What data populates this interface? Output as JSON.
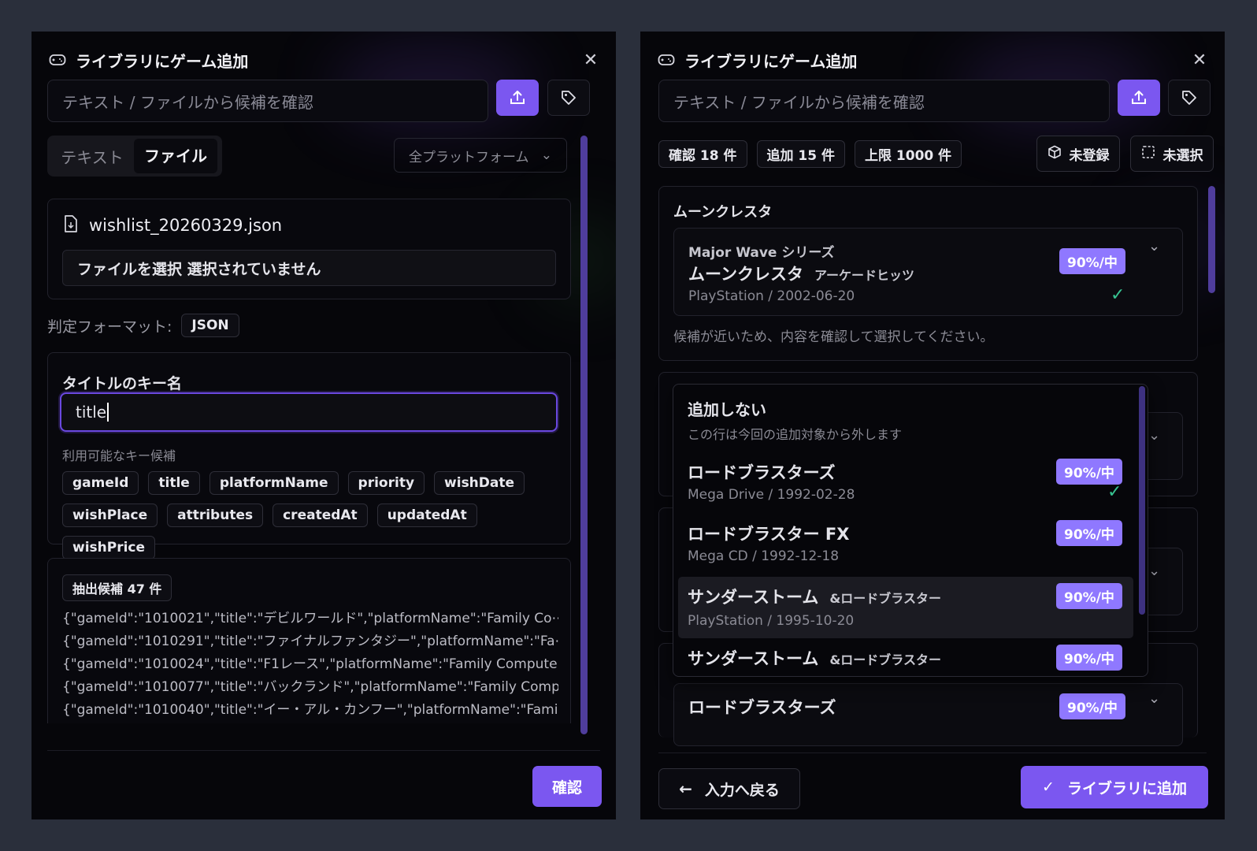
{
  "colors": {
    "accent": "#7b57f0",
    "badge": "#8f78ff",
    "check": "#37c391",
    "background": "#2a2f3b",
    "panel": "#06060a"
  },
  "left": {
    "title": "ライブラリにゲーム追加",
    "search_placeholder": "テキスト / ファイルから候補を確認",
    "tabs": [
      "テキスト",
      "ファイル"
    ],
    "platform_select": "全プラットフォーム",
    "file_name": "wishlist_20260329.json",
    "file_input_label": "ファイルを選択 選択されていません",
    "format_label": "判定フォーマット:",
    "format_value": "JSON",
    "key_label": "タイトルのキー名",
    "key_value": "title",
    "key_candidates_label": "利用可能なキー候補",
    "key_chips": [
      "gameId",
      "title",
      "platformName",
      "priority",
      "wishDate",
      "wishPlace",
      "attributes",
      "createdAt",
      "updatedAt",
      "wishPrice"
    ],
    "extract_label": "抽出候補 47 件",
    "extract_lines": [
      "{\"gameId\":\"1010021\",\"title\":\"デビルワールド\",\"platformName\":\"Family Co⋯",
      "{\"gameId\":\"1010291\",\"title\":\"ファイナルファンタジー\",\"platformName\":\"Fa⋯",
      "{\"gameId\":\"1010024\",\"title\":\"F1レース\",\"platformName\":\"Family Computer⋯",
      "{\"gameId\":\"1010077\",\"title\":\"バックランド\",\"platformName\":\"Family Comp⋯",
      "{\"gameId\":\"1010040\",\"title\":\"イー・アル・カンフー\",\"platformName\":\"Fami⋯"
    ],
    "confirm_button": "確認"
  },
  "right": {
    "title": "ライブラリにゲーム追加",
    "search_placeholder": "テキスト / ファイルから候補を確認",
    "stats": [
      "確認 18 件",
      "追加 15 件",
      "上限 1000 件"
    ],
    "filter_unregistered": "未登録",
    "filter_unselected": "未選択",
    "group1": {
      "heading": "ムーンクレスタ",
      "series": "Major Wave シリーズ",
      "name": "ムーンクレスタ",
      "subtitle": "アーケードヒッツ",
      "meta": "PlayStation / 2002-06-20",
      "badge": "90%/中",
      "note": "候補が近いため、内容を確認して選択してください。"
    },
    "dropdown": {
      "none_title": "追加しない",
      "none_desc": "この行は今回の追加対象から外します",
      "items": [
        {
          "name": "ロードブラスターズ",
          "subtitle": "",
          "meta": "Mega Drive / 1992-02-28",
          "badge": "90%/中"
        },
        {
          "name": "ロードブラスター FX",
          "subtitle": "",
          "meta": "Mega CD / 1992-12-18",
          "badge": "90%/中"
        },
        {
          "name": "サンダーストーム",
          "subtitle": "&ロードブラスター",
          "meta": "PlayStation / 1995-10-20",
          "badge": "90%/中"
        },
        {
          "name": "サンダーストーム",
          "subtitle": "&ロードブラスター",
          "meta": "",
          "badge": "90%/中"
        }
      ]
    },
    "bottom_item": {
      "name": "ロードブラスターズ",
      "badge": "90%/中"
    },
    "back_button": "入力へ戻る",
    "add_button": "ライブラリに追加"
  }
}
